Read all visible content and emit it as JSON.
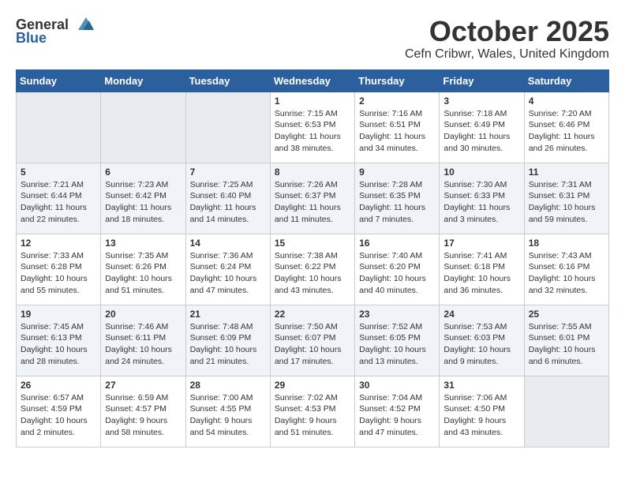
{
  "header": {
    "logo_general": "General",
    "logo_blue": "Blue",
    "month_title": "October 2025",
    "location": "Cefn Cribwr, Wales, United Kingdom"
  },
  "weekdays": [
    "Sunday",
    "Monday",
    "Tuesday",
    "Wednesday",
    "Thursday",
    "Friday",
    "Saturday"
  ],
  "weeks": [
    [
      {
        "day": "",
        "info": ""
      },
      {
        "day": "",
        "info": ""
      },
      {
        "day": "",
        "info": ""
      },
      {
        "day": "1",
        "info": "Sunrise: 7:15 AM\nSunset: 6:53 PM\nDaylight: 11 hours\nand 38 minutes."
      },
      {
        "day": "2",
        "info": "Sunrise: 7:16 AM\nSunset: 6:51 PM\nDaylight: 11 hours\nand 34 minutes."
      },
      {
        "day": "3",
        "info": "Sunrise: 7:18 AM\nSunset: 6:49 PM\nDaylight: 11 hours\nand 30 minutes."
      },
      {
        "day": "4",
        "info": "Sunrise: 7:20 AM\nSunset: 6:46 PM\nDaylight: 11 hours\nand 26 minutes."
      }
    ],
    [
      {
        "day": "5",
        "info": "Sunrise: 7:21 AM\nSunset: 6:44 PM\nDaylight: 11 hours\nand 22 minutes."
      },
      {
        "day": "6",
        "info": "Sunrise: 7:23 AM\nSunset: 6:42 PM\nDaylight: 11 hours\nand 18 minutes."
      },
      {
        "day": "7",
        "info": "Sunrise: 7:25 AM\nSunset: 6:40 PM\nDaylight: 11 hours\nand 14 minutes."
      },
      {
        "day": "8",
        "info": "Sunrise: 7:26 AM\nSunset: 6:37 PM\nDaylight: 11 hours\nand 11 minutes."
      },
      {
        "day": "9",
        "info": "Sunrise: 7:28 AM\nSunset: 6:35 PM\nDaylight: 11 hours\nand 7 minutes."
      },
      {
        "day": "10",
        "info": "Sunrise: 7:30 AM\nSunset: 6:33 PM\nDaylight: 11 hours\nand 3 minutes."
      },
      {
        "day": "11",
        "info": "Sunrise: 7:31 AM\nSunset: 6:31 PM\nDaylight: 10 hours\nand 59 minutes."
      }
    ],
    [
      {
        "day": "12",
        "info": "Sunrise: 7:33 AM\nSunset: 6:28 PM\nDaylight: 10 hours\nand 55 minutes."
      },
      {
        "day": "13",
        "info": "Sunrise: 7:35 AM\nSunset: 6:26 PM\nDaylight: 10 hours\nand 51 minutes."
      },
      {
        "day": "14",
        "info": "Sunrise: 7:36 AM\nSunset: 6:24 PM\nDaylight: 10 hours\nand 47 minutes."
      },
      {
        "day": "15",
        "info": "Sunrise: 7:38 AM\nSunset: 6:22 PM\nDaylight: 10 hours\nand 43 minutes."
      },
      {
        "day": "16",
        "info": "Sunrise: 7:40 AM\nSunset: 6:20 PM\nDaylight: 10 hours\nand 40 minutes."
      },
      {
        "day": "17",
        "info": "Sunrise: 7:41 AM\nSunset: 6:18 PM\nDaylight: 10 hours\nand 36 minutes."
      },
      {
        "day": "18",
        "info": "Sunrise: 7:43 AM\nSunset: 6:16 PM\nDaylight: 10 hours\nand 32 minutes."
      }
    ],
    [
      {
        "day": "19",
        "info": "Sunrise: 7:45 AM\nSunset: 6:13 PM\nDaylight: 10 hours\nand 28 minutes."
      },
      {
        "day": "20",
        "info": "Sunrise: 7:46 AM\nSunset: 6:11 PM\nDaylight: 10 hours\nand 24 minutes."
      },
      {
        "day": "21",
        "info": "Sunrise: 7:48 AM\nSunset: 6:09 PM\nDaylight: 10 hours\nand 21 minutes."
      },
      {
        "day": "22",
        "info": "Sunrise: 7:50 AM\nSunset: 6:07 PM\nDaylight: 10 hours\nand 17 minutes."
      },
      {
        "day": "23",
        "info": "Sunrise: 7:52 AM\nSunset: 6:05 PM\nDaylight: 10 hours\nand 13 minutes."
      },
      {
        "day": "24",
        "info": "Sunrise: 7:53 AM\nSunset: 6:03 PM\nDaylight: 10 hours\nand 9 minutes."
      },
      {
        "day": "25",
        "info": "Sunrise: 7:55 AM\nSunset: 6:01 PM\nDaylight: 10 hours\nand 6 minutes."
      }
    ],
    [
      {
        "day": "26",
        "info": "Sunrise: 6:57 AM\nSunset: 4:59 PM\nDaylight: 10 hours\nand 2 minutes."
      },
      {
        "day": "27",
        "info": "Sunrise: 6:59 AM\nSunset: 4:57 PM\nDaylight: 9 hours\nand 58 minutes."
      },
      {
        "day": "28",
        "info": "Sunrise: 7:00 AM\nSunset: 4:55 PM\nDaylight: 9 hours\nand 54 minutes."
      },
      {
        "day": "29",
        "info": "Sunrise: 7:02 AM\nSunset: 4:53 PM\nDaylight: 9 hours\nand 51 minutes."
      },
      {
        "day": "30",
        "info": "Sunrise: 7:04 AM\nSunset: 4:52 PM\nDaylight: 9 hours\nand 47 minutes."
      },
      {
        "day": "31",
        "info": "Sunrise: 7:06 AM\nSunset: 4:50 PM\nDaylight: 9 hours\nand 43 minutes."
      },
      {
        "day": "",
        "info": ""
      }
    ]
  ]
}
